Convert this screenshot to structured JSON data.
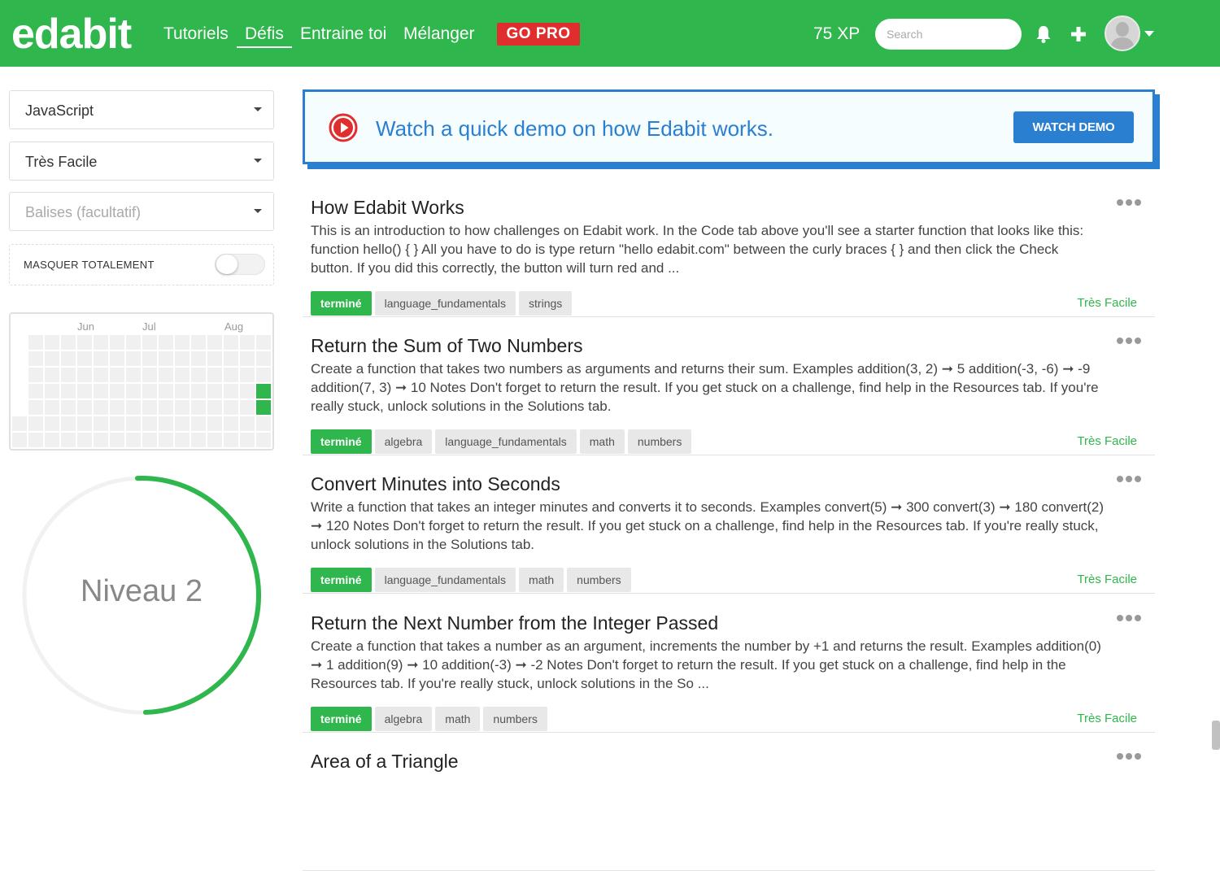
{
  "header": {
    "logo": "edabit",
    "nav": [
      "Tutoriels",
      "Défis",
      "Entraine toi",
      "Mélanger"
    ],
    "active_nav": "Défis",
    "gopro": "GO PRO",
    "xp": "75 XP",
    "search_placeholder": "Search",
    "colors": {
      "brand": "#2fb64c",
      "gopro": "#e02d2d"
    }
  },
  "sidebar": {
    "language": "JavaScript",
    "difficulty": "Très Facile",
    "tags_placeholder": "Balises (facultatif)",
    "hide_label": "MASQUER TOTALEMENT",
    "hide_toggle_on": false,
    "heatmap_months": [
      "Jun",
      "Jul",
      "Aug"
    ],
    "level_label": "Niveau 2",
    "level_progress": 0.5
  },
  "demo": {
    "text": "Watch a quick demo on how Edabit works.",
    "button": "WATCH DEMO",
    "color": "#2a7fd1"
  },
  "challenges": [
    {
      "title": "How Edabit Works",
      "description": "This is an introduction to how challenges on Edabit work. In the Code tab above you'll see a starter function that looks like this: function hello() { } All you have to do is type return \"hello edabit.com\" between the curly braces { } and then click the Check button. If you did this correctly, the button will turn red and ...",
      "tags": [
        "terminé",
        "language_fundamentals",
        "strings"
      ],
      "difficulty": "Très Facile"
    },
    {
      "title": "Return the Sum of Two Numbers",
      "description": "Create a function that takes two numbers as arguments and returns their sum. Examples addition(3, 2) ➞ 5 addition(-3, -6) ➞ -9 addition(7, 3) ➞ 10 Notes Don't forget to return the result. If you get stuck on a challenge, find help in the Resources tab. If you're really stuck, unlock solutions in the Solutions tab.",
      "tags": [
        "terminé",
        "algebra",
        "language_fundamentals",
        "math",
        "numbers"
      ],
      "difficulty": "Très Facile"
    },
    {
      "title": "Convert Minutes into Seconds",
      "description": "Write a function that takes an integer minutes and converts it to seconds. Examples convert(5) ➞ 300 convert(3) ➞ 180 convert(2) ➞ 120 Notes Don't forget to return the result. If you get stuck on a challenge, find help in the Resources tab. If you're really stuck, unlock solutions in the Solutions tab.",
      "tags": [
        "terminé",
        "language_fundamentals",
        "math",
        "numbers"
      ],
      "difficulty": "Très Facile"
    },
    {
      "title": "Return the Next Number from the Integer Passed",
      "description": "Create a function that takes a number as an argument, increments the number by +1 and returns the result. Examples addition(0) ➞ 1 addition(9) ➞ 10 addition(-3) ➞ -2 Notes Don't forget to return the result. If you get stuck on a challenge, find help in the Resources tab. If you're really stuck, unlock solutions in the So ...",
      "tags": [
        "terminé",
        "algebra",
        "math",
        "numbers"
      ],
      "difficulty": "Très Facile"
    },
    {
      "title": "Area of a Triangle",
      "description": "",
      "tags": [],
      "difficulty": ""
    }
  ]
}
